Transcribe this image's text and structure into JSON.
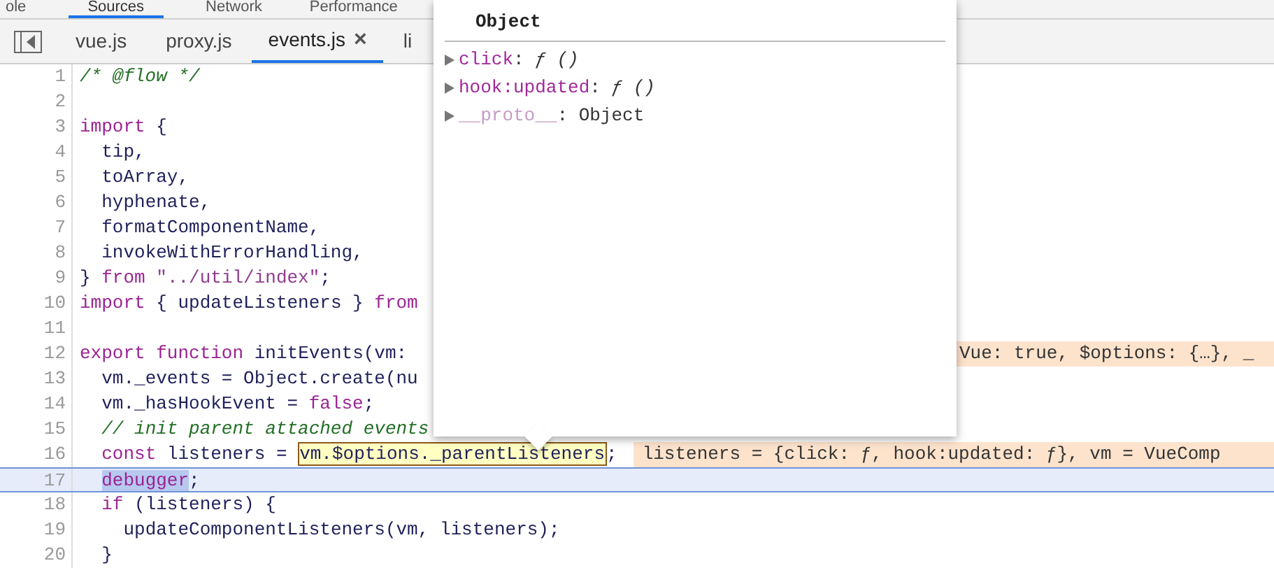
{
  "panel_tabs": [
    {
      "label": "ole",
      "selected": false
    },
    {
      "label": "Sources",
      "selected": true
    },
    {
      "label": "Network",
      "selected": false
    },
    {
      "label": "Performance",
      "selected": false
    }
  ],
  "file_tabs": [
    {
      "label": "vue.js",
      "selected": false,
      "closable": false
    },
    {
      "label": "proxy.js",
      "selected": false,
      "closable": false
    },
    {
      "label": "events.js",
      "selected": true,
      "closable": true
    },
    {
      "label": "li",
      "selected": false,
      "closable": false
    }
  ],
  "close_glyph": "×",
  "code_lines": [
    {
      "number": "1",
      "current": false,
      "segments": [
        {
          "kind": "comment",
          "text": "/* @flow */"
        }
      ]
    },
    {
      "number": "2",
      "current": false
    },
    {
      "number": "3",
      "current": false,
      "segments": [
        {
          "kind": "keyword",
          "text": "import"
        },
        {
          "kind": "plain",
          "text": " {"
        }
      ]
    },
    {
      "number": "4",
      "current": false,
      "segments": [
        {
          "kind": "plain",
          "text": "  tip,"
        }
      ]
    },
    {
      "number": "5",
      "current": false,
      "segments": [
        {
          "kind": "plain",
          "text": "  toArray,"
        }
      ]
    },
    {
      "number": "6",
      "current": false,
      "segments": [
        {
          "kind": "plain",
          "text": "  hyphenate,"
        }
      ]
    },
    {
      "number": "7",
      "current": false,
      "segments": [
        {
          "kind": "plain",
          "text": "  formatComponentName,"
        }
      ]
    },
    {
      "number": "8",
      "current": false,
      "segments": [
        {
          "kind": "plain",
          "text": "  invokeWithErrorHandling,"
        }
      ]
    },
    {
      "number": "9",
      "current": false,
      "segments": [
        {
          "kind": "plain",
          "text": "} "
        },
        {
          "kind": "keyword",
          "text": "from"
        },
        {
          "kind": "string",
          "text": " \"../util/index\""
        },
        {
          "kind": "plain",
          "text": ";"
        }
      ]
    },
    {
      "number": "10",
      "current": false,
      "segments": [
        {
          "kind": "keyword",
          "text": "import"
        },
        {
          "kind": "plain",
          "text": " { updateListeners } "
        },
        {
          "kind": "keyword",
          "text": "from"
        }
      ]
    },
    {
      "number": "11",
      "current": false
    },
    {
      "number": "12",
      "current": false,
      "segments": [
        {
          "kind": "keyword",
          "text": "export"
        },
        {
          "kind": "keyword",
          "text": " function"
        },
        {
          "kind": "plain",
          "text": " initEvents(vm:"
        }
      ],
      "inline_value": {
        "text": "Vue: true, $options: {…}, _",
        "partly_hidden": true
      }
    },
    {
      "number": "13",
      "current": false,
      "segments": [
        {
          "kind": "plain",
          "text": "  vm._events = Object.create(nu"
        }
      ]
    },
    {
      "number": "14",
      "current": false,
      "segments": [
        {
          "kind": "plain",
          "text": "  vm._hasHookEvent = "
        },
        {
          "kind": "keyword",
          "text": "false"
        },
        {
          "kind": "plain",
          "text": ";"
        }
      ]
    },
    {
      "number": "15",
      "current": false,
      "segments": [
        {
          "kind": "comment",
          "text": "  // init parent attached events"
        }
      ]
    },
    {
      "number": "16",
      "current": false,
      "segments": [
        {
          "kind": "keyword",
          "text": "  const"
        },
        {
          "kind": "plain",
          "text": " listeners = "
        },
        {
          "kind": "hovered",
          "text": "vm.$options._parentListeners"
        },
        {
          "kind": "plain",
          "text": ";"
        }
      ],
      "inline_value": {
        "text": "listeners = {click: ƒ, hook:updated: ƒ}, vm = VueComp",
        "partly_hidden": false
      }
    },
    {
      "number": "17",
      "current": true,
      "segments": [
        {
          "kind": "selected",
          "text": "  debugger"
        },
        {
          "kind": "plain",
          "text": ";"
        }
      ]
    },
    {
      "number": "18",
      "current": false,
      "segments": [
        {
          "kind": "keyword",
          "text": "  if"
        },
        {
          "kind": "plain",
          "text": " (listeners) {"
        }
      ]
    },
    {
      "number": "19",
      "current": false,
      "segments": [
        {
          "kind": "plain",
          "text": "    updateComponentListeners(vm, listeners);"
        }
      ]
    },
    {
      "number": "20",
      "current": false,
      "segments": [
        {
          "kind": "plain",
          "text": "  }"
        }
      ]
    }
  ],
  "popover": {
    "title": "Object",
    "properties": [
      {
        "name": "click",
        "separator": ": ",
        "value": "ƒ ()",
        "internal": false
      },
      {
        "name": "hook:updated",
        "separator": ": ",
        "value": "ƒ ()",
        "internal": false
      },
      {
        "name": "__proto__",
        "separator": ": ",
        "value": "Object",
        "internal": true
      }
    ]
  }
}
